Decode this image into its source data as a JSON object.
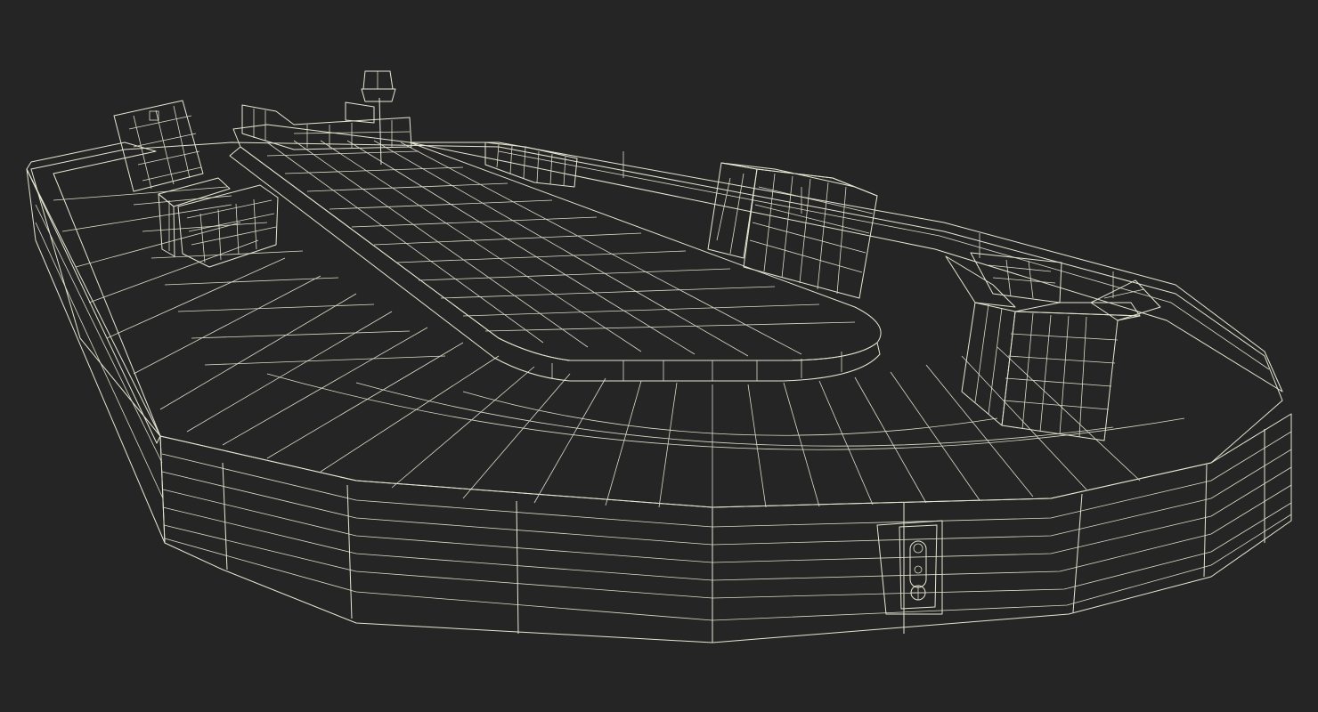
{
  "scene": {
    "background_color": "#252525",
    "mesh_color": "#707064",
    "mesh_top_color": "#7a7a6d",
    "wire_color": "#e6e6d2",
    "objects": [
      "baggage-carousel",
      "center-island",
      "beacon-lamp",
      "box-open",
      "box-closed"
    ]
  }
}
